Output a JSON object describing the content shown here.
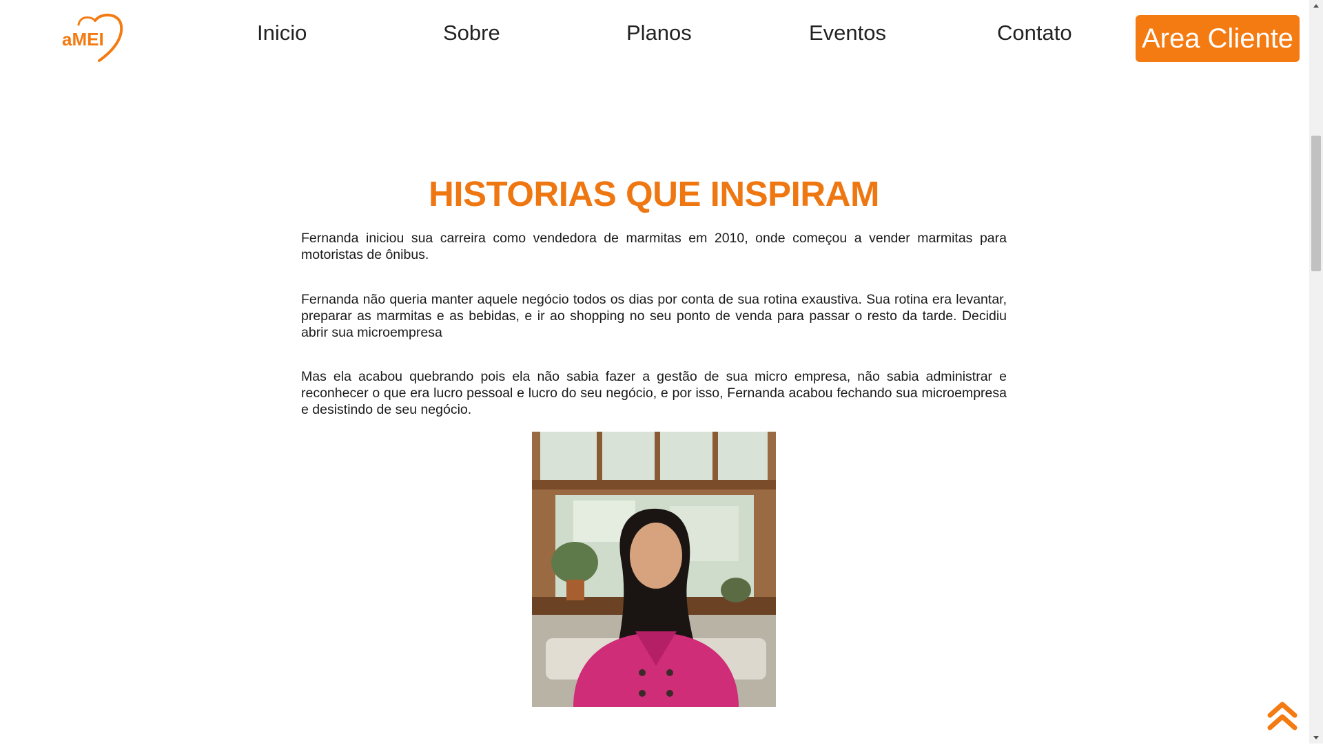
{
  "brand": {
    "logo_text": "aMEI",
    "accent_color": "#f47a12"
  },
  "nav": {
    "items": [
      {
        "label": "Inicio"
      },
      {
        "label": "Sobre"
      },
      {
        "label": "Planos"
      },
      {
        "label": "Eventos"
      },
      {
        "label": "Contato"
      }
    ],
    "cta_label": "Area Cliente"
  },
  "main": {
    "title": "HISTORIAS QUE INSPIRAM",
    "paragraphs": [
      "Fernanda iniciou sua carreira como vendedora de marmitas em 2010, onde começou a vender marmitas para motoristas de ônibus.",
      "Fernanda não queria manter aquele negócio todos os dias por conta de sua rotina exaustiva. Sua rotina era levantar, preparar as marmitas e as bebidas, e ir ao shopping no seu ponto de venda para passar o resto da tarde. Decidiu abrir sua microempresa",
      "Mas ela acabou quebrando pois ela não sabia fazer a gestão de sua micro empresa, não sabia administrar e reconhecer o que era lucro pessoal e lucro do seu negócio, e por isso, Fernanda acabou fechando sua microempresa e desistindo de seu negócio."
    ]
  },
  "icons": {
    "back_to_top": "double-chevron-up-icon",
    "scroll_up": "arrow-up-icon",
    "scroll_down": "arrow-down-icon"
  }
}
